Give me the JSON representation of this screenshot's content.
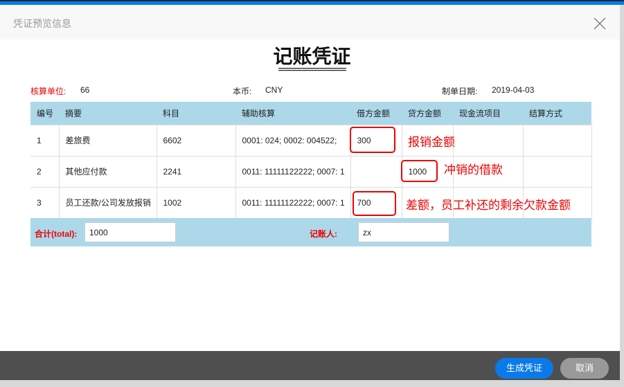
{
  "dialog": {
    "title": "凭证预览信息"
  },
  "voucher": {
    "title": "记账凭证",
    "underline": "==================",
    "unit_label": "核算单位:",
    "unit_value": "66",
    "currency_label": "本币:",
    "currency_value": "CNY",
    "date_label": "制单日期:",
    "date_value": "2019-04-03"
  },
  "table": {
    "headers": [
      "编号",
      "摘要",
      "科目",
      "辅助核算",
      "借方金额",
      "贷方金额",
      "现金流项目",
      "结算方式"
    ],
    "rows": [
      {
        "no": "1",
        "summary": "差旅费",
        "subject": "6602",
        "aux": "0001: 024;  0002: 004522;",
        "debit": "300",
        "credit": "",
        "cash": "",
        "settle": ""
      },
      {
        "no": "2",
        "summary": "其他应付款",
        "subject": "2241",
        "aux": "0011: 11111122222;  0007: 1",
        "debit": "",
        "credit": "1000",
        "cash": "",
        "settle": ""
      },
      {
        "no": "3",
        "summary": "员工还款/公司发放报销",
        "subject": "1002",
        "aux": "0011: 11111122222;  0007: 1",
        "debit": "700",
        "credit": "",
        "cash": "",
        "settle": ""
      }
    ]
  },
  "annotations": [
    "报销金额",
    "冲销的借款",
    "差额，员工补还的剩余欠款金额"
  ],
  "totals": {
    "total_label": "合计(total):",
    "total_value": "1000",
    "bookkeeper_label": "记账人:",
    "bookkeeper_value": "zx"
  },
  "footer": {
    "generate": "生成凭证",
    "cancel": "取消"
  },
  "colors": {
    "accent": "#0a7ae8",
    "header_bg": "#add8ea",
    "annotation": "#e00000"
  }
}
